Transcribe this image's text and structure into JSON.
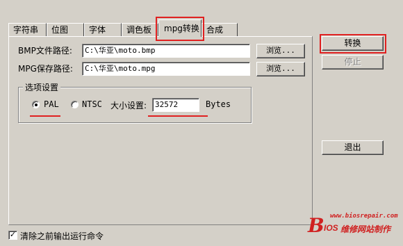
{
  "tabs": [
    {
      "label": "字符串"
    },
    {
      "label": "位图"
    },
    {
      "label": "字体"
    },
    {
      "label": "调色板"
    },
    {
      "label": "mpg转换"
    },
    {
      "label": "合成"
    }
  ],
  "active_tab": "mpg转换",
  "bmp_path": {
    "label": "BMP文件路径:",
    "value": "C:\\华亚\\moto.bmp",
    "browse": "浏览..."
  },
  "mpg_path": {
    "label": "MPG保存路径:",
    "value": "C:\\华亚\\moto.mpg",
    "browse": "浏览..."
  },
  "options": {
    "title": "选项设置",
    "pal_label": "PAL",
    "ntsc_label": "NTSC",
    "pal_selected": true,
    "size_label": "大小设置:",
    "size_value": "32572",
    "size_unit": "Bytes"
  },
  "buttons": {
    "convert": "转换",
    "stop": "停止",
    "exit": "退出"
  },
  "footer": {
    "checkbox_label": "清除之前输出运行命令",
    "checked": true
  },
  "watermark": {
    "url": "www.biosrepair.com",
    "brand": "IOS",
    "text": "维修网站制作"
  },
  "colors": {
    "highlight": "#e02020",
    "background": "#d4d0c8"
  }
}
